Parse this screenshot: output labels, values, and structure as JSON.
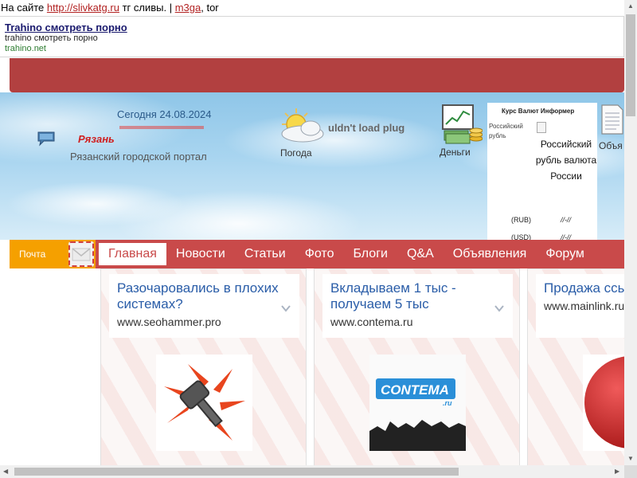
{
  "topline": {
    "prefix": "На сайте",
    "link1": "http://slivkatg.ru",
    "mid": "тг сливы. |",
    "link2": "m3ga",
    "suffix": ", tor"
  },
  "ad": {
    "title": "Trahino смотреть порно",
    "desc": "trahino смотреть порно",
    "url": "trahino.net"
  },
  "header": {
    "date": "Сегодня 24.08.2024",
    "city": "Рязань",
    "portal": "Рязанский городской портал",
    "weather_label": "Погода",
    "plugin_text": "uldn't load plug",
    "money_label": "Деньги",
    "ads_label": "Объя"
  },
  "informer": {
    "title": "Курс Валют Информер",
    "rub_small": "Российский рубль",
    "rub_big": "Российский рубль валюта России",
    "rows": [
      {
        "code": "(RUB)",
        "value": "//-//"
      },
      {
        "code": "(USD)",
        "value": "//-//"
      }
    ]
  },
  "nav": {
    "mail": "Почта",
    "items": [
      "Главная",
      "Новости",
      "Статьи",
      "Фото",
      "Блоги",
      "Q&A",
      "Объявления",
      "Форум"
    ]
  },
  "cards": [
    {
      "title": "Разочаровались в плохих системах?",
      "url": "www.seohammer.pro"
    },
    {
      "title": "Вкладываем 1 тыс - получаем 5 тыс",
      "url": "www.contema.ru"
    },
    {
      "title": "Продажа ссылок кризис",
      "url": "www.mainlink.ru"
    }
  ],
  "contema_logo": {
    "text": "CONTEMA",
    "suffix": ".ru"
  },
  "colors": {
    "red_bar": "#b24040",
    "nav": "#c94a4a",
    "mail": "#f5a000",
    "link_blue": "#2a5da8"
  }
}
